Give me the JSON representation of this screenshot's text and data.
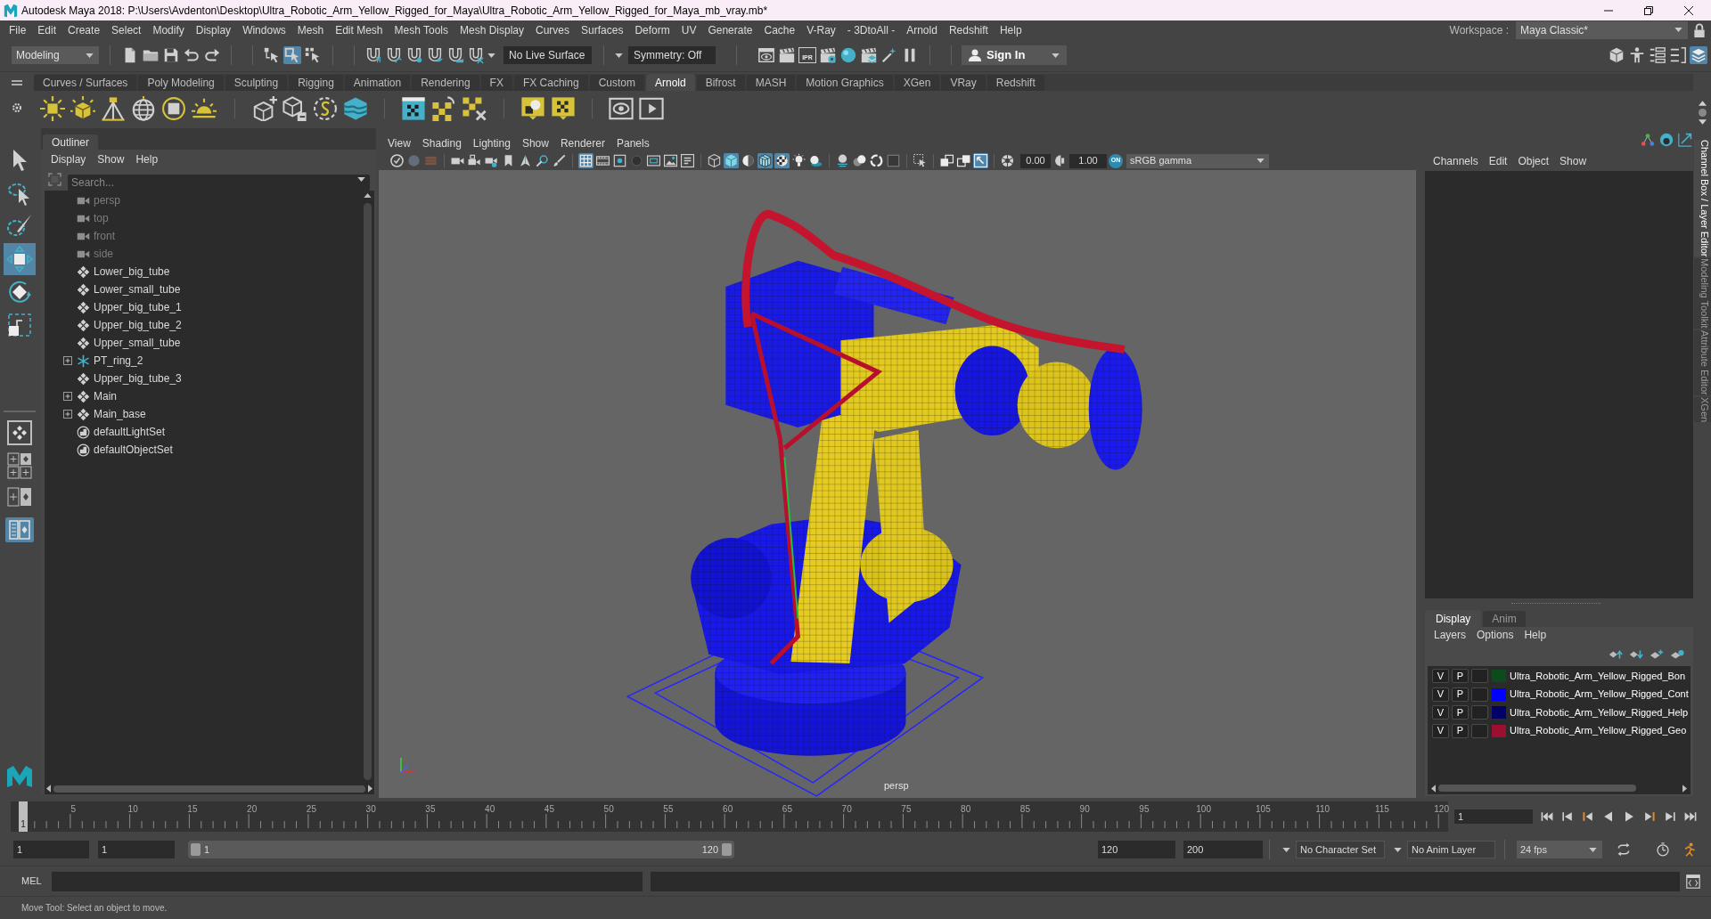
{
  "window": {
    "title": "Autodesk Maya 2018: P:\\Users\\Avdenton\\Desktop\\Ultra_Robotic_Arm_Yellow_Rigged_for_Maya\\Ultra_Robotic_Arm_Yellow_Rigged_for_Maya_mb_vray.mb*"
  },
  "menu_bar": [
    "File",
    "Edit",
    "Create",
    "Select",
    "Modify",
    "Display",
    "Windows",
    "Mesh",
    "Edit Mesh",
    "Mesh Tools",
    "Mesh Display",
    "Curves",
    "Surfaces",
    "Deform",
    "UV",
    "Generate",
    "Cache",
    "V-Ray",
    "- 3DtoAll -",
    "Arnold",
    "Redshift",
    "Help"
  ],
  "workspace": {
    "label": "Workspace :",
    "value": "Maya Classic*"
  },
  "status_line": {
    "menu_set": "Modeling",
    "selection_modes": [
      {
        "selected": false
      },
      {
        "selected": true
      },
      {
        "selected": false
      }
    ],
    "live_surface": "No Live Surface",
    "symmetry": "Symmetry: Off",
    "ipr": "IPR",
    "sign_in": "Sign In",
    "panel_toggles": [
      {
        "on": false
      },
      {
        "on": false
      },
      {
        "on": false
      },
      {
        "on": false
      },
      {
        "on": true
      }
    ]
  },
  "shelf": {
    "tabs": [
      {
        "label": "Curves / Surfaces",
        "selected": false
      },
      {
        "label": "Poly Modeling",
        "selected": false
      },
      {
        "label": "Sculpting",
        "selected": false
      },
      {
        "label": "Rigging",
        "selected": false
      },
      {
        "label": "Animation",
        "selected": false
      },
      {
        "label": "Rendering",
        "selected": false
      },
      {
        "label": "FX",
        "selected": false
      },
      {
        "label": "FX Caching",
        "selected": false
      },
      {
        "label": "Custom",
        "selected": false
      },
      {
        "label": "Arnold",
        "selected": true
      },
      {
        "label": "Bifrost",
        "selected": false
      },
      {
        "label": "MASH",
        "selected": false
      },
      {
        "label": "Motion Graphics",
        "selected": false
      },
      {
        "label": "XGen",
        "selected": false
      },
      {
        "label": "VRay",
        "selected": false
      },
      {
        "label": "Redshift",
        "selected": false
      }
    ]
  },
  "toolbox": {
    "tools": [
      {
        "selected": false
      },
      {
        "selected": false
      },
      {
        "selected": false
      },
      {
        "selected": true
      },
      {
        "selected": false
      },
      {
        "selected": false
      }
    ],
    "layouts": [
      {
        "selected": false
      },
      {
        "selected": false
      },
      {
        "selected": false
      },
      {
        "selected": true
      }
    ]
  },
  "outliner": {
    "title": "Outliner",
    "menu": [
      "Display",
      "Show",
      "Help"
    ],
    "search": {
      "placeholder": "Search..."
    },
    "items": [
      {
        "label": "persp",
        "kind": "camera",
        "dimmed": true,
        "expandable": false
      },
      {
        "label": "top",
        "kind": "camera",
        "dimmed": true,
        "expandable": false
      },
      {
        "label": "front",
        "kind": "camera",
        "dimmed": true,
        "expandable": false
      },
      {
        "label": "side",
        "kind": "camera",
        "dimmed": true,
        "expandable": false
      },
      {
        "label": "Lower_big_tube",
        "kind": "transform",
        "dimmed": false,
        "expandable": false
      },
      {
        "label": "Lower_small_tube",
        "kind": "transform",
        "dimmed": false,
        "expandable": false
      },
      {
        "label": "Upper_big_tube_1",
        "kind": "transform",
        "dimmed": false,
        "expandable": false
      },
      {
        "label": "Upper_big_tube_2",
        "kind": "transform",
        "dimmed": false,
        "expandable": false
      },
      {
        "label": "Upper_small_tube",
        "kind": "transform",
        "dimmed": false,
        "expandable": false
      },
      {
        "label": "PT_ring_2",
        "kind": "locator",
        "dimmed": false,
        "expandable": true
      },
      {
        "label": "Upper_big_tube_3",
        "kind": "transform",
        "dimmed": false,
        "expandable": false
      },
      {
        "label": "Main",
        "kind": "transform",
        "dimmed": false,
        "expandable": true
      },
      {
        "label": "Main_base",
        "kind": "transform",
        "dimmed": false,
        "expandable": true
      },
      {
        "label": "defaultLightSet",
        "kind": "set",
        "dimmed": false,
        "expandable": false
      },
      {
        "label": "defaultObjectSet",
        "kind": "set",
        "dimmed": false,
        "expandable": false
      }
    ]
  },
  "viewport": {
    "menu": [
      "View",
      "Shading",
      "Lighting",
      "Show",
      "Renderer",
      "Panels"
    ],
    "toolbar": {
      "buttons": [
        {
          "on": false,
          "disabled": false
        },
        {
          "on": false,
          "disabled": true
        },
        {
          "on": false,
          "disabled": true
        },
        {
          "on": false,
          "disabled": false
        },
        {
          "on": false,
          "disabled": false
        },
        {
          "on": false,
          "disabled": false
        },
        {
          "on": false,
          "disabled": false
        },
        {
          "on": false,
          "disabled": false
        },
        {
          "on": false,
          "disabled": false
        },
        {
          "on": false,
          "disabled": false
        },
        {
          "on": true,
          "disabled": false
        },
        {
          "on": false,
          "disabled": false
        },
        {
          "on": false,
          "disabled": false
        },
        {
          "on": false,
          "disabled": true
        },
        {
          "on": false,
          "disabled": false
        },
        {
          "on": false,
          "disabled": false
        },
        {
          "on": false,
          "disabled": false
        },
        {
          "on": false,
          "disabled": false
        },
        {
          "on": true,
          "disabled": false
        },
        {
          "on": false,
          "disabled": false
        },
        {
          "on": true,
          "disabled": false
        },
        {
          "on": true,
          "disabled": false
        },
        {
          "on": false,
          "disabled": false
        },
        {
          "on": false,
          "disabled": false
        },
        {
          "on": false,
          "disabled": false
        },
        {
          "on": false,
          "disabled": false
        },
        {
          "on": false,
          "disabled": false
        },
        {
          "on": false,
          "disabled": true
        },
        {
          "on": false,
          "disabled": false
        },
        {
          "on": false,
          "disabled": false
        },
        {
          "on": false,
          "disabled": false
        },
        {
          "on": true,
          "disabled": false
        },
        {
          "on": false,
          "disabled": false
        },
        {
          "on": false,
          "disabled": false
        }
      ],
      "exposure": "0.00",
      "gamma": "1.00",
      "color_management": "ON",
      "color_space": "sRGB gamma"
    },
    "camera": "persp"
  },
  "channel_box": {
    "menu": [
      "Channels",
      "Edit",
      "Object",
      "Show"
    ]
  },
  "side_tabs": [
    {
      "label": "Channel Box / Layer Editor",
      "selected": true
    },
    {
      "label": "Modeling Toolkit",
      "selected": false
    },
    {
      "label": "Attribute Editor",
      "selected": false
    },
    {
      "label": "XGen",
      "selected": false
    }
  ],
  "layer_editor": {
    "tabs": [
      {
        "label": "Display",
        "selected": true
      },
      {
        "label": "Anim",
        "selected": false
      }
    ],
    "menu": [
      "Layers",
      "Options",
      "Help"
    ],
    "layers": [
      {
        "visibility": "V",
        "playback": "P",
        "name": "Ultra_Robotic_Arm_Yellow_Rigged_Bon",
        "color": "#0d4a1e"
      },
      {
        "visibility": "V",
        "playback": "P",
        "name": "Ultra_Robotic_Arm_Yellow_Rigged_Cont",
        "color": "#0000ff"
      },
      {
        "visibility": "V",
        "playback": "P",
        "name": "Ultra_Robotic_Arm_Yellow_Rigged_Help",
        "color": "#000066"
      },
      {
        "visibility": "V",
        "playback": "P",
        "name": "Ultra_Robotic_Arm_Yellow_Rigged_Geo",
        "color": "#9b0f30"
      }
    ]
  },
  "time_slider": {
    "ticks": [
      "5",
      "10",
      "15",
      "20",
      "25",
      "30",
      "35",
      "40",
      "45",
      "50",
      "55",
      "60",
      "65",
      "70",
      "75",
      "80",
      "85",
      "90",
      "95",
      "100",
      "105",
      "110",
      "115",
      "120"
    ],
    "current_frame": "1",
    "frame_field": "1"
  },
  "range_slider": {
    "start": "1",
    "playback_start": "1",
    "level": 1,
    "range_start": "1",
    "range_end": "120",
    "playback_end": "120",
    "end": "200",
    "character_set": "No Character Set",
    "anim_layer": "No Anim Layer",
    "fps": "24 fps"
  },
  "command_line": {
    "language": "MEL"
  },
  "help_line": "Move Tool: Select an object to move."
}
